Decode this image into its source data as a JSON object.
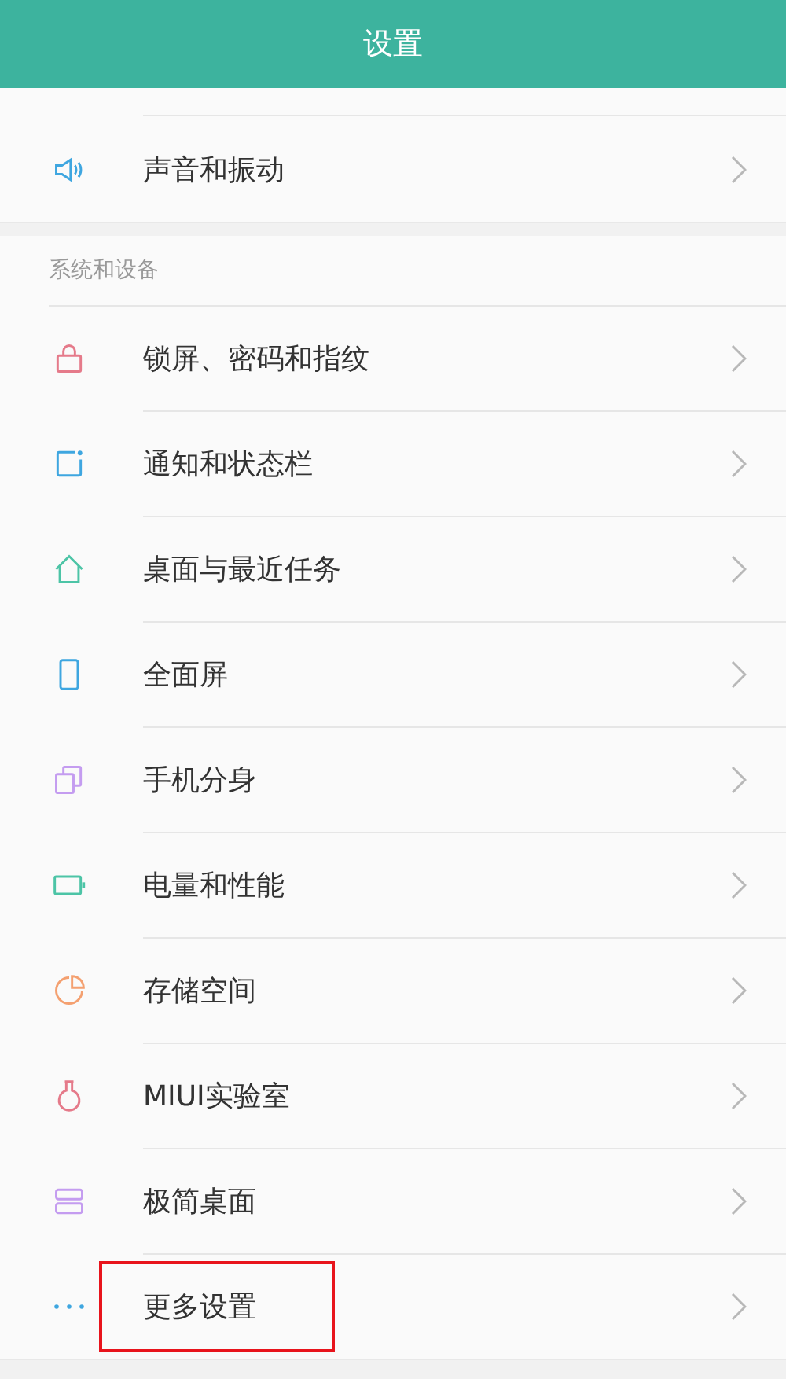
{
  "header": {
    "title": "设置"
  },
  "top_items": [
    {
      "label": "声音和振动",
      "kind": "speaker",
      "color": "#3ea6e0",
      "highlighted": false
    }
  ],
  "section": {
    "title": "系统和设备",
    "items": [
      {
        "label": "锁屏、密码和指纹",
        "kind": "lock",
        "color": "#e57a8a",
        "highlighted": false
      },
      {
        "label": "通知和状态栏",
        "kind": "notification",
        "color": "#3ea6e0",
        "highlighted": false
      },
      {
        "label": "桌面与最近任务",
        "kind": "home",
        "color": "#4cc4a6",
        "highlighted": false
      },
      {
        "label": "全面屏",
        "kind": "phone",
        "color": "#3ea6e0",
        "highlighted": false
      },
      {
        "label": "手机分身",
        "kind": "copies",
        "color": "#c49cf0",
        "highlighted": false
      },
      {
        "label": "电量和性能",
        "kind": "battery",
        "color": "#4cc4a6",
        "highlighted": false
      },
      {
        "label": "存储空间",
        "kind": "pie",
        "color": "#f4a070",
        "highlighted": false
      },
      {
        "label": "MIUI实验室",
        "kind": "flask",
        "color": "#e57a8a",
        "highlighted": false
      },
      {
        "label": "极简桌面",
        "kind": "layers",
        "color": "#c49cf0",
        "highlighted": false
      },
      {
        "label": "更多设置",
        "kind": "dots",
        "color": "#3ea6e0",
        "highlighted": true
      }
    ]
  }
}
